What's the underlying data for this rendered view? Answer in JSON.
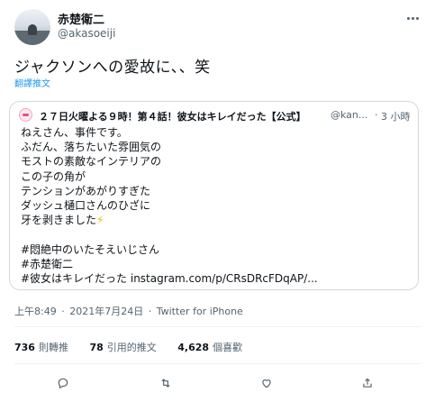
{
  "header": {
    "display_name": "赤楚衛二",
    "handle": "@akasoeiji"
  },
  "tweet": {
    "text": "ジャクソンへの愛故に、、笑",
    "translate_label": "翻譯推文"
  },
  "quote": {
    "name": "２７日火曜よる９時！第４話！彼女はキレイだった【公式】",
    "handle": "@kan...",
    "dot": "·",
    "time": "3 小時",
    "lines": [
      "ねえさん、事件です。",
      "ふだん、落ちたいた雰囲気の",
      "モストの素敵なインテリアの",
      "この子の角が",
      "テンションがあがりすぎた",
      "ダッシュ樋口さんのひざに",
      "牙を剥きました"
    ],
    "zap": "⚡",
    "tags": [
      "#悶絶中のいたそえいじさん",
      "#赤楚衛二",
      "#彼女はキレイだった instagram.com/p/CRsDRcFDqAP/..."
    ]
  },
  "meta": {
    "time": "上午8:49",
    "sep1": "·",
    "date": "2021年7月24日",
    "sep2": "·",
    "client": "Twitter for iPhone"
  },
  "stats": {
    "retweets_count": "736",
    "retweets_label": "則轉推",
    "quotes_count": "78",
    "quotes_label": "引用的推文",
    "likes_count": "4,628",
    "likes_label": "個喜歡"
  },
  "colors": {
    "accent": "#1d9bf0",
    "text": "#0f1419",
    "muted": "#536471",
    "border": "#cfd9de"
  },
  "icons": {
    "more": "more-dots-icon",
    "reply": "reply-icon",
    "retweet": "retweet-icon",
    "like": "heart-icon",
    "share": "share-icon"
  }
}
